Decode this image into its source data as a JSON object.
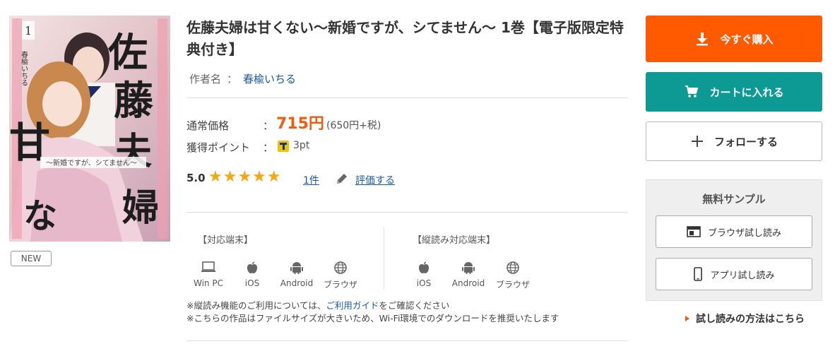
{
  "product": {
    "title": "佐藤夫婦は甘くない～新婚ですが、シてません～ 1巻【電子版限定特典付き】",
    "cover_text": {
      "series_title": "佐藤夫婦は甘くない",
      "subtitle": "～新婚ですが、シてません～",
      "volume": "1",
      "author_on_cover": "春楡いちる"
    },
    "new_badge": "NEW"
  },
  "author": {
    "label": "作者名",
    "sep": "：",
    "name": "春楡いちる"
  },
  "pricing": {
    "regular_label": "通常価格",
    "colon": "：",
    "price": "715円",
    "tax_note": "(650円+税)",
    "points_label": "獲得ポイント",
    "points": "3pt"
  },
  "rating": {
    "score": "5.0",
    "stars": "★★★★★",
    "value": 5,
    "max": 5,
    "count": "1件",
    "review_link": "評価する"
  },
  "devices": {
    "supported_head": "【対応端末】",
    "supported": [
      {
        "label": "Win PC",
        "icon": "pc-icon"
      },
      {
        "label": "iOS",
        "icon": "apple-icon"
      },
      {
        "label": "Android",
        "icon": "android-icon"
      },
      {
        "label": "ブラウザ",
        "icon": "globe-icon"
      }
    ],
    "vertical_head": "【縦読み対応端末】",
    "vertical": [
      {
        "label": "iOS",
        "icon": "apple-icon"
      },
      {
        "label": "Android",
        "icon": "android-icon"
      },
      {
        "label": "ブラウザ",
        "icon": "globe-icon"
      }
    ]
  },
  "notes": {
    "line1_pre": "※縦読み機能のご利用については、",
    "line1_link": "ご利用ガイド",
    "line1_post": "をご確認ください",
    "line2": "※こちらの作品はファイルサイズが大きいため、Wi-Fi環境でのダウンロードを推奨いたします"
  },
  "actions": {
    "buy": "今すぐ購入",
    "cart": "カートに入れる",
    "follow": "フォローする"
  },
  "sample": {
    "title": "無料サンプル",
    "browser": "ブラウザ試し読み",
    "app": "アプリ試し読み",
    "howto": "試し読みの方法はこちら"
  },
  "colors": {
    "buy": "#ff5a00",
    "cart": "#0d9a94",
    "price": "#f05a12",
    "link": "#1a5aa6",
    "star": "#f5a70b"
  }
}
